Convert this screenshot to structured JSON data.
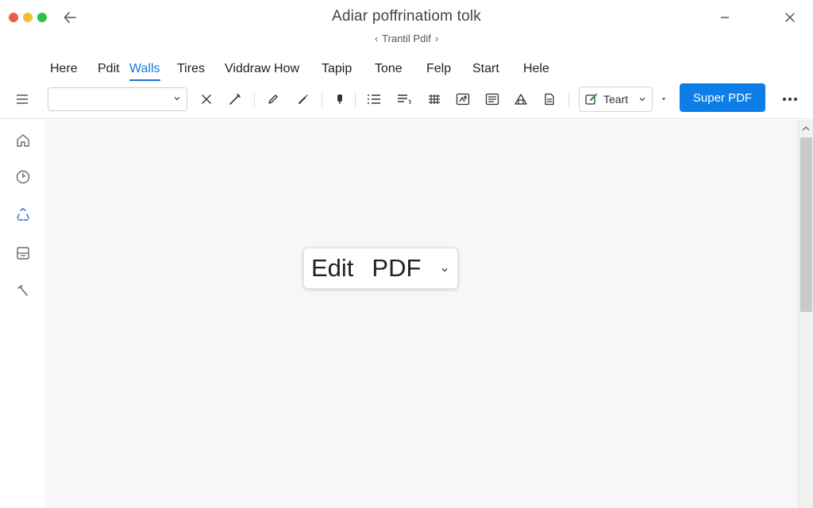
{
  "window": {
    "title": "Adiar poffrinatiom tolk",
    "doc_nav_label": "Trantil Pdif",
    "controls": {
      "red": "#ee5a52",
      "yellow": "#f5bd2e",
      "green": "#2bc142"
    }
  },
  "menu": {
    "items": [
      "Here",
      "Pdit",
      "Walls",
      "Tires",
      "Viddraw",
      "How",
      "Tapip",
      "Tone",
      "Felp",
      "Start",
      "Hele"
    ],
    "active": "Walls"
  },
  "toolbar": {
    "font_select_value": "",
    "text_dropdown_label": "Teart",
    "primary_button_label": "Super PDF",
    "accent_color": "#0d7ee8",
    "icons": [
      "close-icon",
      "slash-pen-icon",
      "pencil-icon",
      "brush-icon",
      "marker-icon",
      "list-icon",
      "text-lines-icon",
      "grid-icon",
      "image-insert-icon",
      "layers-icon",
      "shape-icon",
      "page-icon",
      "edit-image-icon",
      "more-icon"
    ]
  },
  "sidebar": {
    "icons": [
      "home-icon",
      "recent-icon",
      "recycle-icon",
      "save-icon",
      "tool-icon"
    ],
    "active_color": "#1a73d9"
  },
  "canvas": {
    "mode_dropdown": {
      "word1": "Edit",
      "word2": "PDF"
    }
  }
}
